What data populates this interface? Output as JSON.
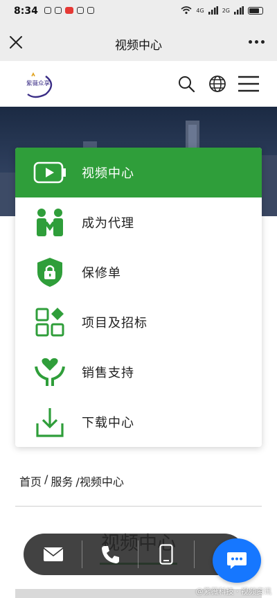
{
  "status_bar": {
    "time": "8:34",
    "network_label": "4G",
    "network_label_2": "2G"
  },
  "nav_bar": {
    "title": "视频中心"
  },
  "header": {
    "logo_text": "紫薇众享"
  },
  "menu": {
    "items": [
      {
        "label": "视频中心",
        "icon": "video-play-icon",
        "active": true
      },
      {
        "label": "成为代理",
        "icon": "agent-people-icon",
        "active": false
      },
      {
        "label": "保修单",
        "icon": "warranty-shield-lock-icon",
        "active": false
      },
      {
        "label": "项目及招标",
        "icon": "project-grid-icon",
        "active": false
      },
      {
        "label": "销售支持",
        "icon": "sales-heart-hands-icon",
        "active": false
      },
      {
        "label": "下载中心",
        "icon": "download-icon",
        "active": false
      }
    ]
  },
  "breadcrumb": {
    "home": "首页",
    "sep1": "/",
    "services": "服务",
    "sep2": "/视频中心"
  },
  "section": {
    "title": "视频中心"
  },
  "contact_bar": {
    "items": [
      "email-icon",
      "phone-icon",
      "mobile-icon"
    ]
  },
  "watermark": "@紫薇科技 · 视频资讯",
  "colors": {
    "accent": "#2f9e3a",
    "chat_button": "#1677ff"
  }
}
